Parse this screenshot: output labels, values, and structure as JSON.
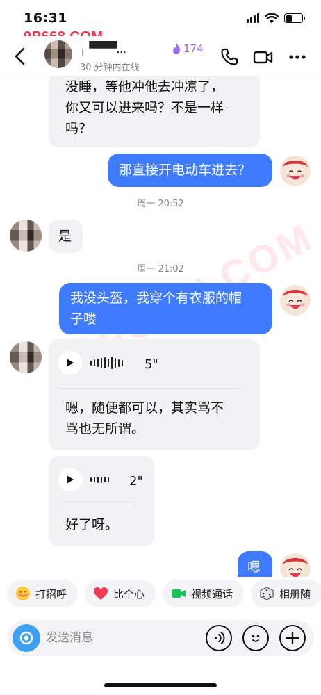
{
  "status_bar": {
    "time": "16:31"
  },
  "watermark": {
    "text": "9P668.COM",
    "diagonal": "91PORN.COM"
  },
  "header": {
    "contact_name": "╷ ▀▀▀...",
    "fire_count": "174",
    "online_status": "30 分钟内在线"
  },
  "messages": {
    "m1_lines": [
      "没睡，等他冲他去冲凉了，",
      "你又可以进来吗？不是一样",
      "吗？"
    ],
    "m2": "那直接开电动车进去？",
    "ts1": "周一 20:52",
    "m3": "是",
    "ts2": "周一 21:02",
    "m4_lines": [
      "我没头盔，我穿个有衣服的帽",
      "子喽"
    ],
    "voice1": {
      "duration": "5\"",
      "transcript_lines": [
        "嗯，随便都可以，其实骂不",
        "骂也无所谓。"
      ]
    },
    "voice2": {
      "duration": "2\"",
      "transcript": "好了呀。"
    },
    "m5": "嗯"
  },
  "quick_actions": [
    {
      "icon": "smile-emoji-icon",
      "label": "打招呼"
    },
    {
      "icon": "heart-icon",
      "label": "比个心"
    },
    {
      "icon": "video-call-icon",
      "label": "视频通话"
    },
    {
      "icon": "dice-icon",
      "label": "相册随"
    }
  ],
  "input": {
    "placeholder": "发送消息"
  },
  "colors": {
    "accent": "#3e7bff",
    "bubble_in": "#f2f2f4",
    "fire": "#9b6bf2",
    "camera": "#3ea0f5"
  }
}
